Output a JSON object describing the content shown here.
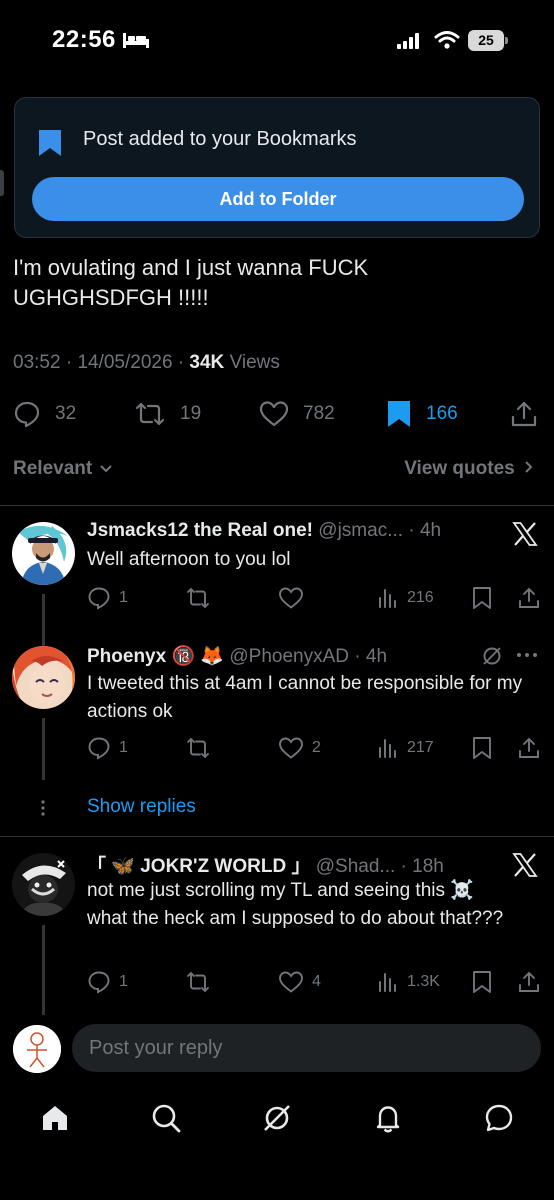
{
  "status_bar": {
    "time": "22:56",
    "battery": "25"
  },
  "toast": {
    "message": "Post added to your Bookmarks",
    "button": "Add to Folder"
  },
  "post": {
    "text": "I'm ovulating and I just wanna FUCK UGHGHSDFGH !!!!!",
    "time": "03:52",
    "date": "14/05/2026",
    "views_count": "34K",
    "views_label": "Views",
    "stats": {
      "replies": "32",
      "reposts": "19",
      "likes": "782",
      "bookmarks": "166"
    }
  },
  "filter": {
    "left": "Relevant",
    "right": "View quotes"
  },
  "replies": [
    {
      "name": "Jsmacks12 the Real one!",
      "handle": "@jsmac...",
      "time": "4h",
      "text": "Well afternoon to you lol",
      "stats": {
        "replies": "1",
        "reposts": "",
        "likes": "",
        "views": "216"
      }
    },
    {
      "name": "Phoenyx",
      "badges": "🔞 🦊",
      "handle": "@PhoenyxAD",
      "time": "4h",
      "text": "I tweeted this at 4am I cannot be responsible for my actions ok",
      "stats": {
        "replies": "1",
        "reposts": "",
        "likes": "2",
        "views": "217"
      }
    },
    {
      "name_prefix": "「",
      "name": "🦋 JOKR'Z WORLD",
      "name_suffix": "」",
      "handle": "@Shad...",
      "time": "18h",
      "text": "not me just scrolling my TL and seeing this ☠️ what the heck am I supposed to do about that???",
      "stats": {
        "replies": "1",
        "reposts": "",
        "likes": "4",
        "views": "1.3K"
      }
    }
  ],
  "show_replies": "Show replies",
  "reply_bar": {
    "placeholder": "Post your reply"
  },
  "colors": {
    "accent": "#1d9bf0",
    "button": "#3a8fe8",
    "muted": "#71767b",
    "background": "#000000"
  },
  "icons": [
    "bed-icon",
    "signal-icon",
    "wifi-icon",
    "bookmark-icon",
    "reply-icon",
    "repost-icon",
    "like-icon",
    "views-icon",
    "share-icon",
    "x-logo-icon",
    "grok-icon",
    "more-icon",
    "home-icon",
    "search-icon",
    "notifications-icon",
    "messages-icon"
  ]
}
